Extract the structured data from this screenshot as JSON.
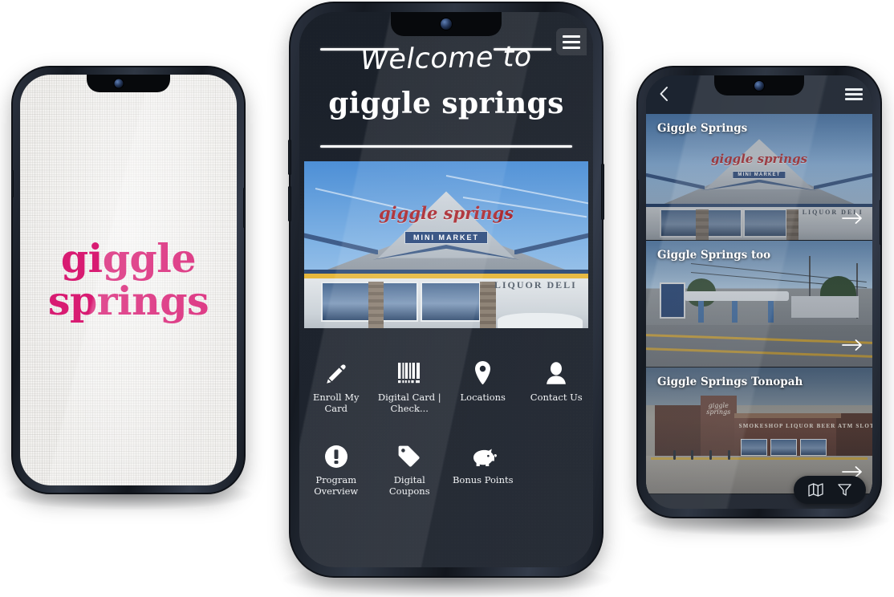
{
  "left_phone": {
    "name": "splash-screen",
    "brand_line1": "giggle",
    "brand_line2": "springs",
    "brand_color": "#d81b72",
    "background_color": "#f2f1ef"
  },
  "center_phone": {
    "name": "home-screen",
    "menu_icon": "hamburger-icon",
    "welcome_script": "Welcome to",
    "brand_title": "giggle springs",
    "hero": {
      "name": "storefront-photo",
      "logo_text": "giggle springs",
      "logo_sub": "MINI  MARKET",
      "side_sign": "LIQUOR  DELI"
    },
    "tiles": [
      {
        "label": "Enroll My Card",
        "icon": "pencil-icon"
      },
      {
        "label": "Digital Card | Check...",
        "icon": "barcode-icon"
      },
      {
        "label": "Locations",
        "icon": "map-pin-icon"
      },
      {
        "label": "Contact Us",
        "icon": "person-icon"
      },
      {
        "label": "Program Overview",
        "icon": "exclamation-circle-icon"
      },
      {
        "label": "Digital Coupons",
        "icon": "tag-icon"
      },
      {
        "label": "Bonus Points",
        "icon": "piggy-bank-icon"
      }
    ]
  },
  "right_phone": {
    "name": "locations-screen",
    "back_icon": "chevron-left-icon",
    "menu_icon": "hamburger-icon",
    "cards": [
      {
        "title": "Giggle Springs",
        "arrow": "arrow-right-icon"
      },
      {
        "title": "Giggle Springs too",
        "arrow": "arrow-right-icon"
      },
      {
        "title": "Giggle Springs Tonopah",
        "arrow": "arrow-right-icon"
      }
    ],
    "tonopah_sign": "SMOKESHOP LIQUOR BEER ATM SLOTS",
    "tonopah_logo": "giggle springs",
    "toolbar": [
      {
        "icon": "map-icon"
      },
      {
        "icon": "filter-icon"
      }
    ]
  }
}
